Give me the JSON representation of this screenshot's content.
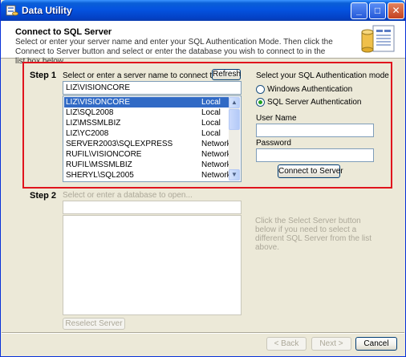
{
  "window": {
    "title": "Data Utility"
  },
  "titlebar": {
    "minimize": "_",
    "maximize": "□",
    "close": "✕"
  },
  "header": {
    "title": "Connect to SQL Server",
    "description": "Select or enter your server name and enter your SQL Authentication Mode.  Then click the Connect to Server button and select or enter the database you wish to connect to in the list box below."
  },
  "step1": {
    "label": "Step 1",
    "prompt": "Select or enter a server name to connect to...",
    "refresh_label": "Refresh",
    "server_value": "LIZ\\VISIONCORE",
    "servers": [
      {
        "name": "LIZ\\VISIONCORE",
        "type": "Local",
        "selected": true
      },
      {
        "name": "LIZ\\SQL2008",
        "type": "Local"
      },
      {
        "name": "LIZ\\MSSMLBIZ",
        "type": "Local"
      },
      {
        "name": "LIZ\\YC2008",
        "type": "Local"
      },
      {
        "name": "SERVER2003\\SQLEXPRESS",
        "type": "Network"
      },
      {
        "name": "RUFIL\\VISIONCORE",
        "type": "Network"
      },
      {
        "name": "RUFIL\\MSSMLBIZ",
        "type": "Network"
      },
      {
        "name": "SHERYL\\SQL2005",
        "type": "Network"
      }
    ],
    "auth_heading": "Select your SQL Authentication mode",
    "auth_options": [
      {
        "label": "Windows Authentication",
        "selected": false
      },
      {
        "label": "SQL Server Authentication",
        "selected": true
      }
    ],
    "username_label": "User Name",
    "username_value": "",
    "password_label": "Password",
    "password_value": "",
    "connect_label": "Connect to Server"
  },
  "step2": {
    "label": "Step 2",
    "prompt": "Select or enter a database to open...",
    "database_value": "",
    "info": "Click the Select Server button below if you need to select a different SQL Server from the list above.",
    "reselect_label": "Reselect Server"
  },
  "footer": {
    "back_label": "< Back",
    "next_label": "Next >",
    "cancel_label": "Cancel"
  },
  "colors": {
    "highlight": "#e0141d",
    "selection": "#316ac5",
    "titlebar": "#0553e0"
  }
}
